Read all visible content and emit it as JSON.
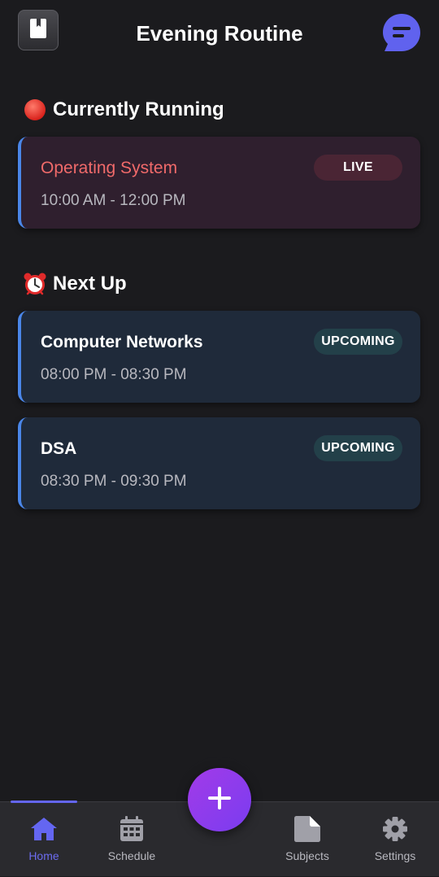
{
  "header": {
    "title": "Evening Routine",
    "left_icon": "book-icon",
    "right_icon": "chat-icon"
  },
  "running": {
    "section_title": "Currently Running",
    "section_icon": "red-circle-icon",
    "cards": [
      {
        "title": "Operating System",
        "time": "10:00 AM - 12:00 PM",
        "badge": "LIVE"
      }
    ]
  },
  "next": {
    "section_title": "Next Up",
    "section_icon": "alarm-clock-icon",
    "cards": [
      {
        "title": "Computer Networks",
        "time": "08:00 PM - 08:30 PM",
        "badge": "UPCOMING"
      },
      {
        "title": "DSA",
        "time": "08:30 PM - 09:30 PM",
        "badge": "UPCOMING"
      }
    ]
  },
  "nav": {
    "items": [
      {
        "label": "Home",
        "icon": "home-icon",
        "active": true
      },
      {
        "label": "Schedule",
        "icon": "calendar-icon",
        "active": false
      },
      {
        "label": "Subjects",
        "icon": "document-icon",
        "active": false
      },
      {
        "label": "Settings",
        "icon": "gear-icon",
        "active": false
      }
    ],
    "fab_icon": "plus-icon"
  },
  "colors": {
    "background": "#1b1b1e",
    "accent": "#6466f1",
    "live_title": "#f06a6a",
    "card_border": "#4a86e8",
    "fab": "#8b3cf0"
  }
}
